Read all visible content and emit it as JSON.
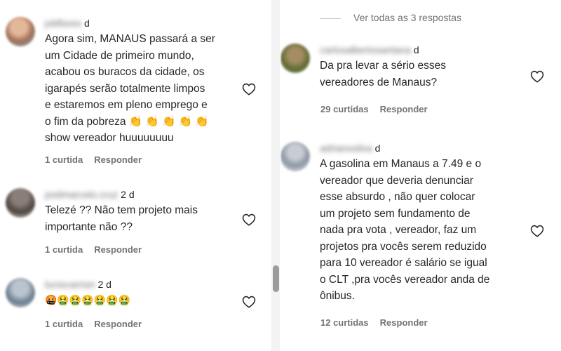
{
  "left_comments": [
    {
      "user": "jvbflores",
      "age": "d",
      "text": "Agora sim, MANAUS passará a ser\num Cidade de primeiro mundo,\nacabou os buracos da cidade, os\nigarapés serão totalmente limpos\ne estaremos em pleno emprego e\no fim da pobreza 👏 👏 👏 👏 👏\nshow vereador huuuuuuuu",
      "likes": "1 curtida",
      "reply": "Responder"
    },
    {
      "user": "josilmarcelo.cruz",
      "age": "2 d",
      "text": "Telezé ?? Não tem projeto mais\nimportante não ??",
      "likes": "1 curtida",
      "reply": "Responder"
    },
    {
      "user": "luciocarrion",
      "age": "2 d",
      "text": "🤬🤮🤮🤮🤮🤮🤮",
      "likes": "1 curtida",
      "reply": "Responder"
    }
  ],
  "see_all_replies": "Ver todas as 3 respostas",
  "right_comments": [
    {
      "user": "carlosalbertosantana",
      "age": "d",
      "text": "Da pra levar a sério esses\nvereadores de Manaus?",
      "likes": "29 curtidas",
      "reply": "Responder"
    },
    {
      "user": "adrianosilva",
      "age": "d",
      "text": "A gasolina em Manaus a 7.49 e o\nvereador que deveria denunciar\nesse absurdo , não quer colocar\num projeto sem fundamento de\nnada pra vota , vereador, faz um\nprojetos pra vocês serem reduzido\npara 10 vereador é salário se igual\no CLT ,pra vocês vereador anda de\nônibus.",
      "likes": "12 curtidas",
      "reply": "Responder"
    }
  ],
  "icons": {
    "like": "heart-outline-icon"
  },
  "colors": {
    "text": "#262626",
    "secondary": "#737373"
  }
}
